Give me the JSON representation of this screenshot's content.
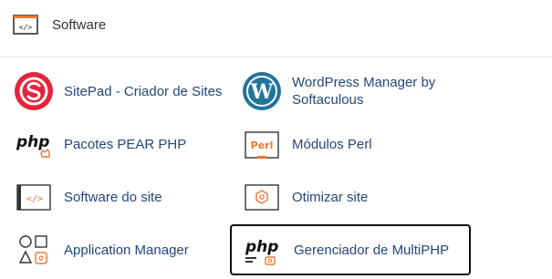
{
  "section": {
    "title": "Software",
    "icon": "code-window-icon"
  },
  "items": [
    {
      "label": "SitePad - Criador de Sites",
      "icon": "sitepad-logo-icon"
    },
    {
      "label": "WordPress Manager by Softaculous",
      "icon": "wordpress-logo-icon"
    },
    {
      "label": "Pacotes PEAR PHP",
      "icon": "php-pear-icon",
      "icon_text": "php"
    },
    {
      "label": "Módulos Perl",
      "icon": "perl-module-icon",
      "icon_text": "Perl"
    },
    {
      "label": "Software do site",
      "icon": "code-window-icon"
    },
    {
      "label": "Otimizar site",
      "icon": "optimize-hexagon-icon"
    },
    {
      "label": "Application Manager",
      "icon": "app-shapes-icon"
    },
    {
      "label": "Gerenciador de MultiPHP",
      "icon": "multiphp-icon",
      "icon_text": "php",
      "selected": true
    }
  ],
  "colors": {
    "link": "#23477a",
    "accent_orange": "#e8782f",
    "sitepad_red": "#e5243b",
    "wordpress_blue": "#21759b"
  }
}
